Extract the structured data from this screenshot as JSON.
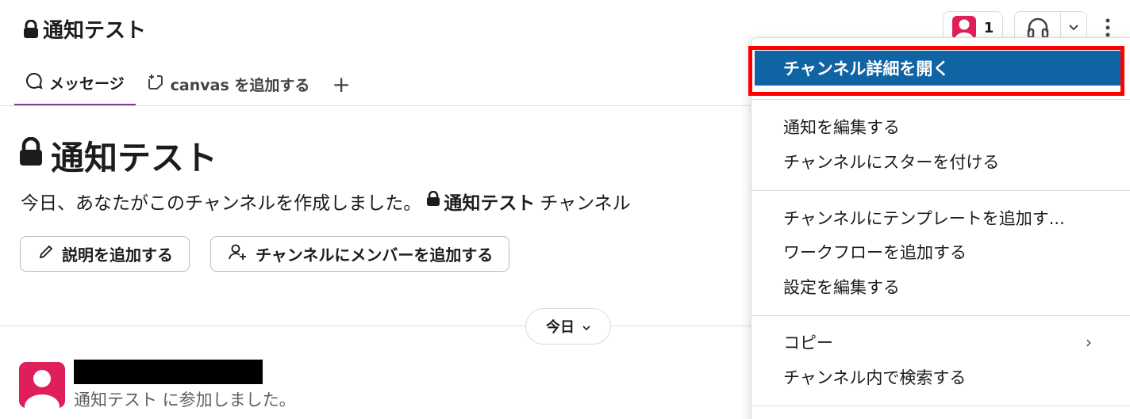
{
  "header": {
    "channel_name": "通知テスト",
    "member_count": "1"
  },
  "tabs": [
    {
      "label": "メッセージ"
    },
    {
      "label": "canvas を追加する"
    }
  ],
  "channel_intro": {
    "title": "通知テスト",
    "description_prefix": "今日、あなたがこのチャンネルを作成しました。",
    "description_channel": "通知テスト",
    "description_suffix": "チャンネル"
  },
  "actions": {
    "add_description": "説明を追加する",
    "add_members": "チャンネルにメンバーを追加する"
  },
  "date_divider": {
    "label": "今日"
  },
  "message": {
    "text": "通知テスト に参加しました。"
  },
  "menu": {
    "highlighted": "チャンネル詳細を開く",
    "items": [
      "通知を編集する",
      "チャンネルにスターを付ける",
      "チャンネルにテンプレートを追加す...",
      "ワークフローを追加する",
      "設定を編集する",
      "コピー",
      "チャンネル内で検索する"
    ]
  },
  "colors": {
    "accent": "#1164a3",
    "avatar": "#e01e5a",
    "tab_underline": "#7e3d8f",
    "highlight_frame": "#ff0000"
  }
}
